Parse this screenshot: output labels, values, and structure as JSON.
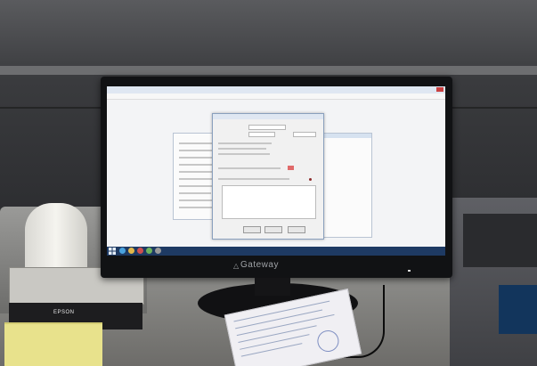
{
  "scene": {
    "monitor_brand": "Gateway",
    "printer_label": "EPSON"
  },
  "screen": {
    "window_title": ""
  },
  "colors": {
    "taskbar": "#1e3a63",
    "screen_bg": "#f3f4f6",
    "desk": "#8f8f8c"
  }
}
